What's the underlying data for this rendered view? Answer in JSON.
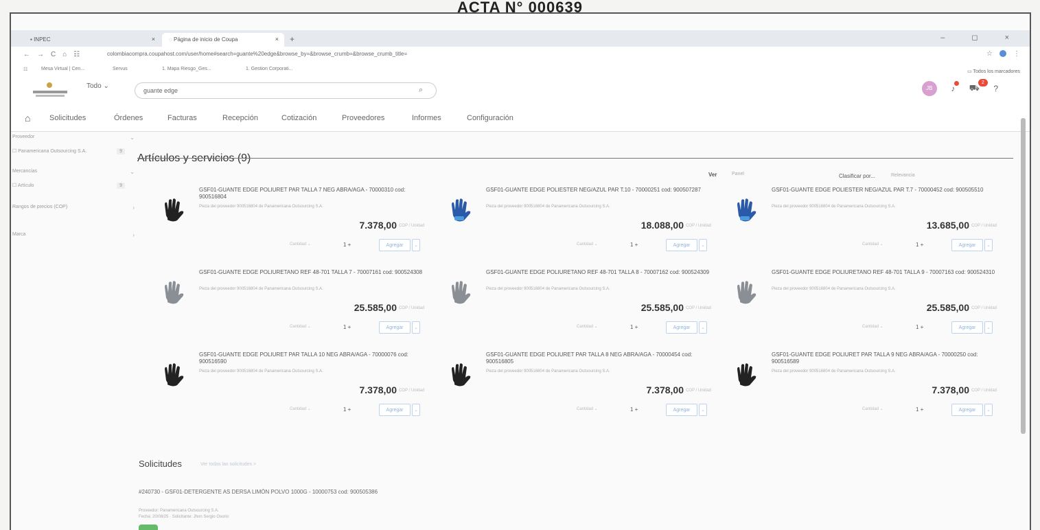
{
  "document": {
    "title": "ACTA N° 000639"
  },
  "browser": {
    "tabs": [
      {
        "label": "INPEC",
        "icon": "inpec-tab-icon"
      },
      {
        "label": "Página de inicio de Coupa",
        "icon": "coupa-tab-icon"
      }
    ],
    "new_tab": "+",
    "window_controls": "– ◻ ×",
    "url": "colombiacompra.coupahost.com/user/home#search=guante%20edge&browse_by=&browse_crumb=&browse_crumb_title=",
    "bookmarks": [
      "Mesa Virtual | Cen...",
      "Servus",
      "1. Mapa Riesgo_Ges...",
      "1. Gestion Corporati..."
    ],
    "bookmarks_folder": "Todos los marcadores"
  },
  "app": {
    "search_scope": "Todo",
    "search_value": "guante edge",
    "menu": [
      "Solicitudes",
      "Órdenes",
      "Facturas",
      "Recepción",
      "Cotización",
      "Proveedores",
      "Informes",
      "Configuración"
    ],
    "user_initials": "JB",
    "cart_count": "2",
    "help": "?"
  },
  "filters": [
    {
      "label": "Proveedor",
      "count": ""
    },
    {
      "label": "Panamericana Outsourcing S.A.",
      "count": "9"
    },
    {
      "label": "Mercancías",
      "count": ""
    },
    {
      "label": "Artículo",
      "count": "9"
    },
    {
      "label": "Rangos de precios (COP)",
      "count": ""
    },
    {
      "label": "Marca",
      "count": ""
    }
  ],
  "results": {
    "title": "Artículos y servicios (9)",
    "view_label": "Ver",
    "view_value": "Panel",
    "sort_label": "Clasificar por...",
    "sort_value": "Relevancia",
    "add_label": "Agregar",
    "qty_label": "Cantidad",
    "qty_value": "1",
    "unit_label": "COP / Unidad",
    "supplier_line": "Pieza del proveedor 900516804 de Panamericana Outsourcing S.A.",
    "items": [
      {
        "title": "GSF01-GUANTE EDGE POLIURET PAR TALLA 7 NEG ABRA/AGA - 70000310 cod: 900516804",
        "price": "7.378,00",
        "glove": "black"
      },
      {
        "title": "GSF01-GUANTE EDGE POLIESTER NEG/AZUL PAR T.10 - 70000251 cod: 900507287",
        "price": "18.088,00",
        "glove": "blue"
      },
      {
        "title": "GSF01-GUANTE EDGE POLIESTER NEG/AZUL PAR T.7 - 70000452 cod: 900505510",
        "price": "13.685,00",
        "glove": "blue"
      },
      {
        "title": "GSF01-GUANTE EDGE POLIURETANO REF 48-701 TALLA 7 - 70007161 cod: 900524308",
        "price": "25.585,00",
        "glove": "grey"
      },
      {
        "title": "GSF01-GUANTE EDGE POLIURETANO REF 48-701 TALLA 8 - 70007162 cod: 900524309",
        "price": "25.585,00",
        "glove": "grey"
      },
      {
        "title": "GSF01-GUANTE EDGE POLIURETANO REF 48-701 TALLA 9 - 70007163 cod: 900524310",
        "price": "25.585,00",
        "glove": "grey"
      },
      {
        "title": "GSF01-GUANTE EDGE POLIURET PAR TALLA 10 NEG ABRA/AGA - 70000076 cod: 900516590",
        "price": "7.378,00",
        "glove": "black"
      },
      {
        "title": "GSF01-GUANTE EDGE POLIURET PAR TALLA 8 NEG ABRA/AGA - 70000454 cod: 900516805",
        "price": "7.378,00",
        "glove": "black"
      },
      {
        "title": "GSF01-GUANTE EDGE POLIURET PAR TALLA 9 NEG ABRA/AGA - 70000250 cod: 900516589",
        "price": "7.378,00",
        "glove": "black"
      }
    ]
  },
  "requests": {
    "title": "Solicitudes",
    "link": "Ver todas las solicitudes >",
    "item": "#240730 - GSF01-DETERGENTE AS DERSA LIMÓN POLVO 1000G - 10000753 cod: 900505386",
    "meta1": "Proveedor: Panamericana Outsourcing S.A.",
    "meta2": "Fecha: 20/08/25 · Solicitante: Jhon Sergio Osorio"
  },
  "colors": {
    "accent": "#5a8ed6",
    "badge": "#e84b3a",
    "status": "#66bb6a"
  }
}
